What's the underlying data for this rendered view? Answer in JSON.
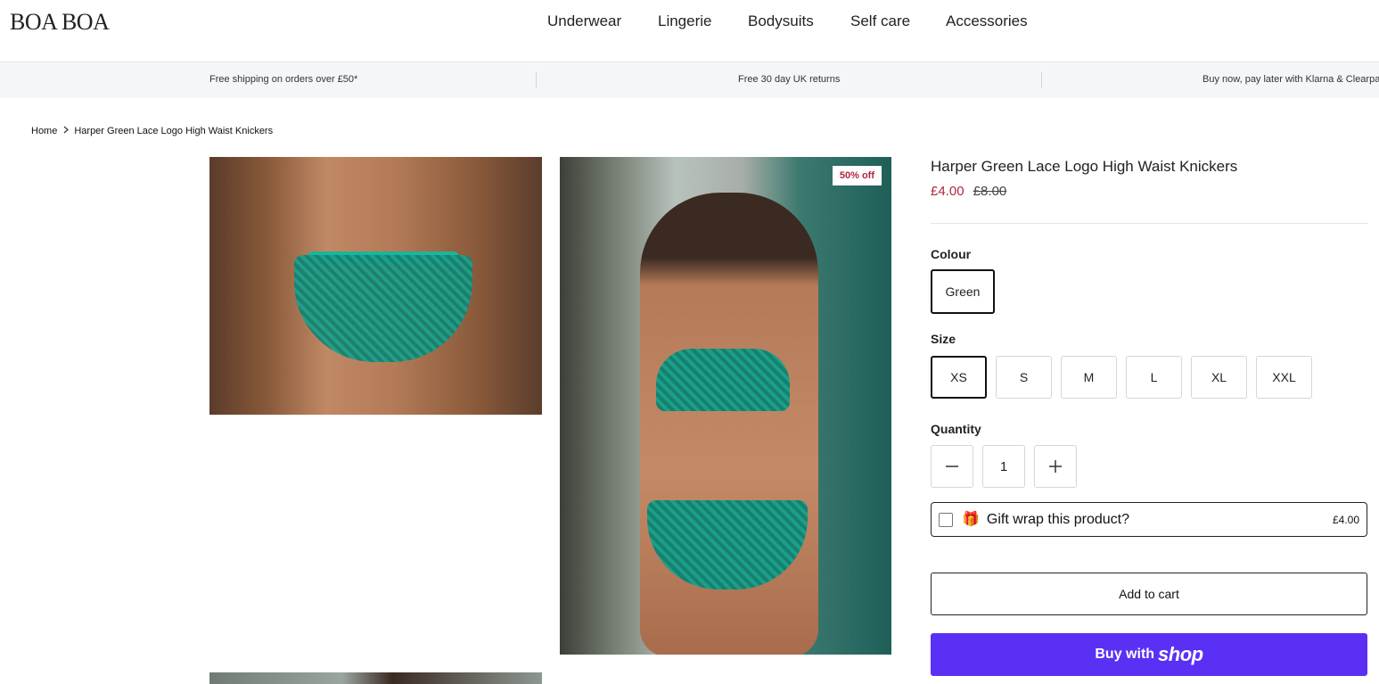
{
  "header": {
    "logo": "BOA BOA",
    "nav": [
      "Underwear",
      "Lingerie",
      "Bodysuits",
      "Self care",
      "Accessories"
    ]
  },
  "promo": [
    "Free shipping on orders over £50*",
    "Free 30 day UK returns",
    "Buy now, pay later with Klarna & Clearpay"
  ],
  "breadcrumb": {
    "home": "Home",
    "current": "Harper Green Lace Logo High Waist Knickers"
  },
  "gallery": {
    "badge": "50% off"
  },
  "product": {
    "title": "Harper Green Lace Logo High Waist Knickers",
    "price": "£4.00",
    "compare_price": "£8.00",
    "colour_label": "Colour",
    "colour_selected": "Green",
    "size_label": "Size",
    "sizes": [
      "XS",
      "S",
      "M",
      "L",
      "XL",
      "XXL"
    ],
    "size_selected": "XS",
    "quantity_label": "Quantity",
    "quantity": "1",
    "gift_wrap_label": "Gift wrap this product?",
    "gift_wrap_price": "£4.00",
    "add_to_cart": "Add to cart",
    "buy_with": "Buy with",
    "shop_brand": "shop"
  },
  "colors": {
    "sale": "#b1263b",
    "shop_pay": "#5a31f4",
    "border": "#d6d6d6",
    "promo_bg": "#f5f6f7"
  },
  "icons": {
    "breadcrumb_separator": "chevron-right-icon",
    "quantity_decrease": "minus-icon",
    "quantity_increase": "plus-icon",
    "gift": "gift-icon"
  }
}
